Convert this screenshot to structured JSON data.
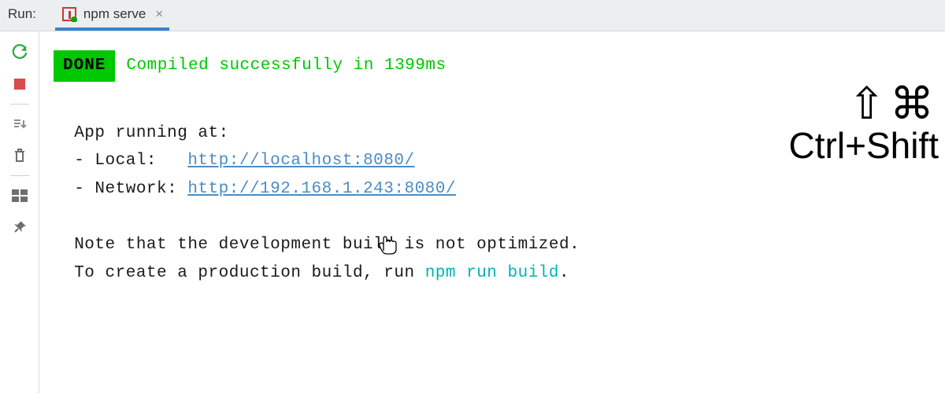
{
  "header": {
    "run_label": "Run:",
    "tab_title": "npm serve",
    "tab_close": "×"
  },
  "sidebar": {
    "rerun": "rerun-icon",
    "stop": "stop-icon",
    "scroll": "scroll-to-end-icon",
    "trash": "trash-icon",
    "layout": "layout-icon",
    "pin": "pin-icon"
  },
  "console": {
    "done_label": "DONE",
    "compiled_msg": "Compiled successfully in 1399ms",
    "app_running": "  App running at:",
    "local_prefix": "  - Local:   ",
    "local_url": "http://localhost:8080/",
    "network_prefix": "  - Network: ",
    "network_url": "http://192.168.1.243:8080/",
    "note_line1": "  Note that the development build is not optimized.",
    "note_line2_a": "  To create a production build, run ",
    "note_line2_cmd": "npm run build",
    "note_line2_b": "."
  },
  "overlay": {
    "symbols": "⇧⌘",
    "text": "Ctrl+Shift"
  }
}
